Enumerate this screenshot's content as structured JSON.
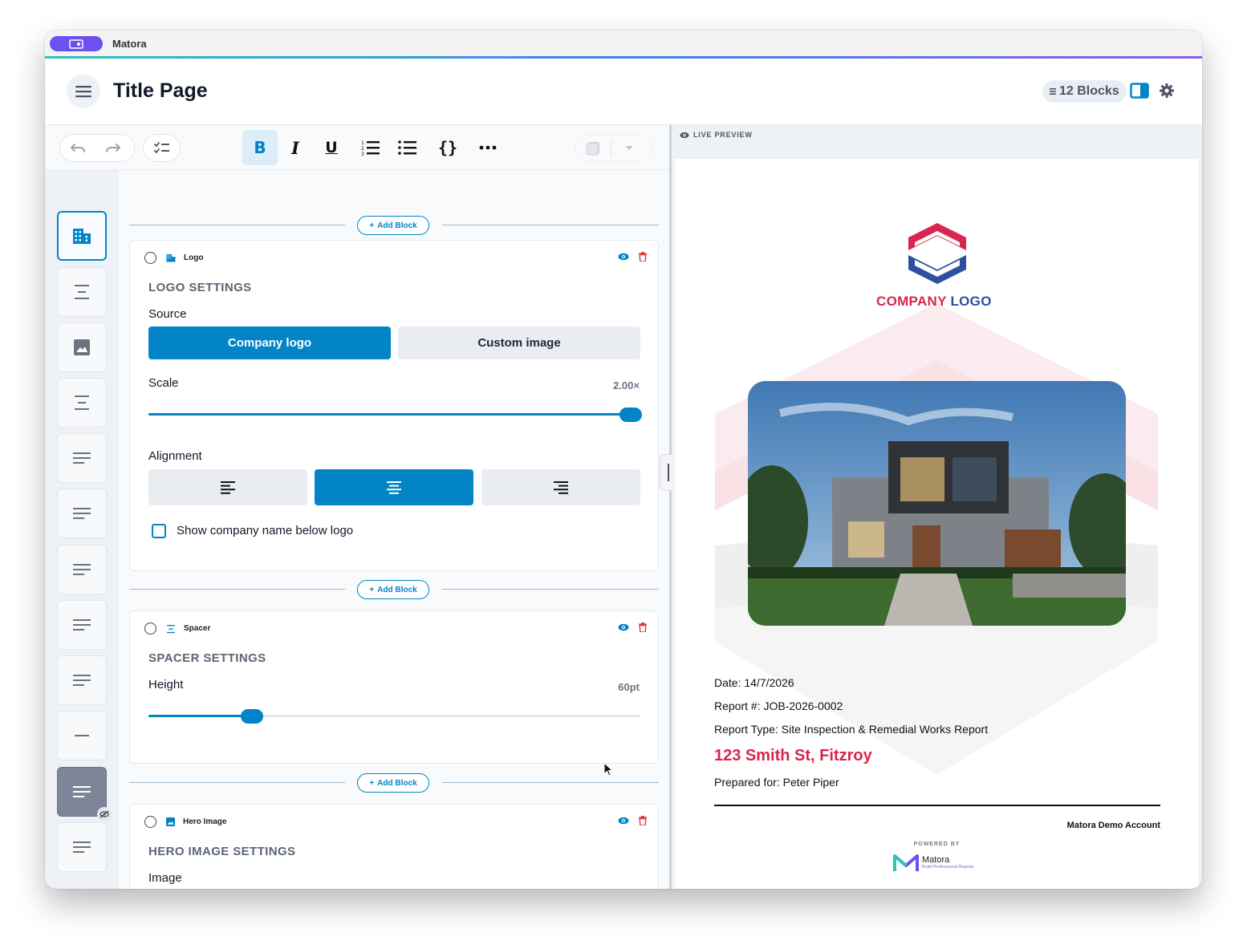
{
  "window": {
    "app_name": "Matora"
  },
  "header": {
    "title": "Title Page",
    "blocks_badge": "12 Blocks"
  },
  "toolbar": {
    "icons": [
      "undo-icon",
      "redo-icon",
      "checklist-icon",
      "bold-icon",
      "italic-icon",
      "underline-icon",
      "ordered-list-icon",
      "bullet-list-icon",
      "braces-icon",
      "more-icon",
      "document-icon",
      "chevron-down-icon"
    ]
  },
  "rail": {
    "items": [
      "logo",
      "spacer",
      "image",
      "spacer",
      "text",
      "text",
      "text",
      "text",
      "text",
      "divider",
      "text-hidden",
      "text"
    ]
  },
  "editor": {
    "add_block_label": "Add Block",
    "logo_card": {
      "type": "Logo",
      "section_title": "LOGO SETTINGS",
      "source_label": "Source",
      "source_options": [
        "Company logo",
        "Custom image"
      ],
      "source_selected": "Company logo",
      "scale_label": "Scale",
      "scale_value": "2.00×",
      "scale_fraction": 0.98,
      "alignment_label": "Alignment",
      "alignment_selected": "center",
      "show_name_label": "Show company name below logo",
      "show_name_checked": false
    },
    "spacer_card": {
      "type": "Spacer",
      "section_title": "SPACER SETTINGS",
      "height_label": "Height",
      "height_value": "60pt",
      "height_fraction": 0.21
    },
    "hero_card": {
      "type": "Hero Image",
      "section_title": "HERO IMAGE SETTINGS",
      "image_label": "Image"
    }
  },
  "preview": {
    "label": "LIVE PREVIEW",
    "logo_text_1": "COMPANY",
    "logo_text_2": "LOGO",
    "date_line": "Date: 14/7/2026",
    "report_no_line": "Report #: JOB-2026-0002",
    "report_type_line": "Report Type: Site Inspection & Remedial Works Report",
    "address": "123 Smith St, Fitzroy",
    "prepared_for_line": "Prepared for: Peter Piper",
    "account": "Matora Demo Account",
    "powered_by": "POWERED BY",
    "brand_name": "Matora",
    "brand_tagline": "Build Professional Reports"
  },
  "colors": {
    "accent": "#0284c7",
    "brand_red": "#d7264f",
    "brand_blue": "#2e4ea3",
    "brand_purple": "#6d4ff2"
  }
}
